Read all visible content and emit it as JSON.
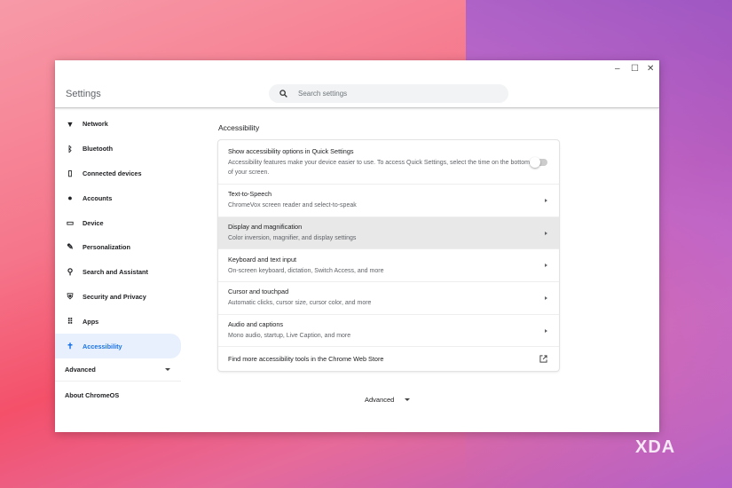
{
  "window": {
    "title": "Settings",
    "search_placeholder": "Search settings",
    "minimize": "–",
    "maximize": "☐",
    "close": "✕"
  },
  "sidebar": {
    "items": [
      {
        "label": "Network",
        "icon": "wifi-icon"
      },
      {
        "label": "Bluetooth",
        "icon": "bluetooth-icon"
      },
      {
        "label": "Connected devices",
        "icon": "phone-icon"
      },
      {
        "label": "Accounts",
        "icon": "person-icon"
      },
      {
        "label": "Device",
        "icon": "laptop-icon"
      },
      {
        "label": "Personalization",
        "icon": "brush-icon"
      },
      {
        "label": "Search and Assistant",
        "icon": "search-icon"
      },
      {
        "label": "Security and Privacy",
        "icon": "shield-icon"
      },
      {
        "label": "Apps",
        "icon": "apps-grid-icon"
      },
      {
        "label": "Accessibility",
        "icon": "accessibility-icon",
        "selected": true
      }
    ],
    "advanced": "Advanced",
    "about": "About ChromeOS"
  },
  "main": {
    "section_title": "Accessibility",
    "quick_settings": {
      "title": "Show accessibility options in Quick Settings",
      "desc": "Accessibility features make your device easier to use. To access Quick Settings, select the time on the bottom of your screen.",
      "enabled": false
    },
    "rows": [
      {
        "title": "Text-to-Speech",
        "desc": "ChromeVox screen reader and select-to-speak"
      },
      {
        "title": "Display and magnification",
        "desc": "Color inversion, magnifier, and display settings"
      },
      {
        "title": "Keyboard and text input",
        "desc": "On-screen keyboard, dictation, Switch Access, and more"
      },
      {
        "title": "Cursor and touchpad",
        "desc": "Automatic clicks, cursor size, cursor color, and more"
      },
      {
        "title": "Audio and captions",
        "desc": "Mono audio, startup, Live Caption, and more"
      }
    ],
    "store_link": "Find more accessibility tools in the Chrome Web Store",
    "advanced": "Advanced"
  },
  "watermark": "XDA"
}
